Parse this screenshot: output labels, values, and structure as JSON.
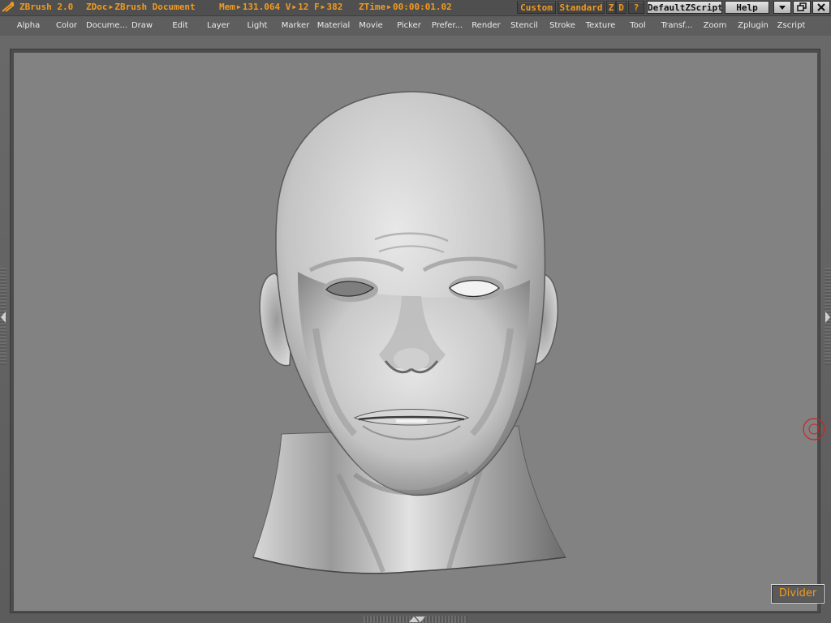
{
  "titlebar": {
    "app_name": "ZBrush 2.0",
    "doc_label": "ZDoc",
    "doc_name": "ZBrush Document",
    "mem_label": "Mem",
    "mem_value": "131.064",
    "v_label": "V",
    "v_value": "12",
    "f_label": "F",
    "f_value": "382",
    "ztime_label": "ZTime",
    "ztime_value": "00:00:01.02",
    "buttons": {
      "custom": "Custom",
      "standard": "Standard",
      "z": "Z",
      "d": "D",
      "help_q": "?",
      "default_zscript": "DefaultZScript",
      "help": "Help"
    },
    "window_icons": [
      "minimize-icon",
      "restore-icon",
      "close-icon"
    ]
  },
  "menubar": {
    "items": [
      "Alpha",
      "Color",
      "Docume...",
      "Draw",
      "Edit",
      "Layer",
      "Light",
      "Marker",
      "Material",
      "Movie",
      "Picker",
      "Prefer...",
      "Render",
      "Stencil",
      "Stroke",
      "Texture",
      "Tool",
      "Transf...",
      "Zoom",
      "Zplugin",
      "Zscript"
    ]
  },
  "canvas": {
    "background_color": "#828282",
    "model_icon": "head-sculpt-3d-model"
  },
  "divider": {
    "label": "Divider"
  },
  "colors": {
    "accent": "#f09a20",
    "menu_text": "#ececec",
    "ui_gray": "#5e5e5e",
    "cursor_ring": "#cc2222"
  }
}
